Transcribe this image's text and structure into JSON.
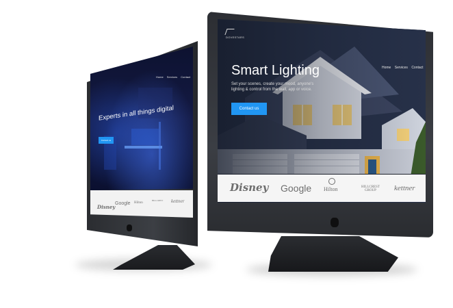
{
  "right_screen": {
    "logo_text": "DOVESTARS",
    "nav": [
      "Home",
      "Services",
      "Contact"
    ],
    "hero_title": "Smart Lighting",
    "hero_subtitle": "Set your scenes, create your mood, anyone's lighting & control from the wall, app or voice.",
    "cta_label": "Contact us",
    "brands": {
      "disney": "Disney",
      "google": "Google",
      "hilton": "Hilton",
      "hillcrest_top": "HILLCREST",
      "hillcrest_bottom": "GROUP",
      "kettner": "kettner"
    }
  },
  "left_screen": {
    "nav": [
      "Home",
      "Services",
      "Contact"
    ],
    "hero_title": "Experts in all things digital",
    "cta_label": "Contact us",
    "brands": {
      "disney": "Disney",
      "google": "Google",
      "hilton": "Hilton",
      "hillcrest": "HILLCREST",
      "kettner": "kettner"
    }
  },
  "colors": {
    "accent": "#2196f3",
    "bezel": "#2f3136",
    "logo_strip": "#f5f5f5"
  }
}
